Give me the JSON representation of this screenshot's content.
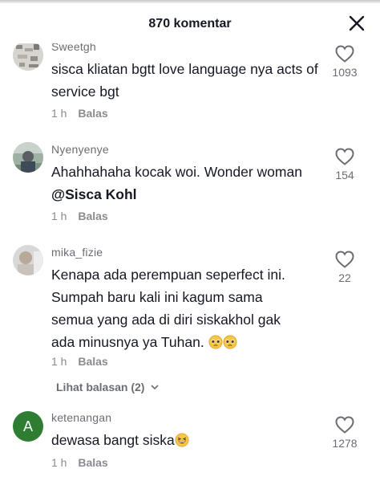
{
  "header": {
    "title": "870 komentar",
    "close_icon": "close-icon"
  },
  "comments": [
    {
      "username": "Sweetgh",
      "text": "sisca kliatan bgtt love language nya acts of service bgt",
      "time": "1 h",
      "reply_label": "Balas",
      "likes": "1093"
    },
    {
      "username": "Nyenyenye",
      "text": "Ahahhahaha kocak woi. Wonder woman",
      "mention": "@Sisca Kohl",
      "time": "1 h",
      "reply_label": "Balas",
      "likes": "154"
    },
    {
      "username": "mika_fizie",
      "text": "Kenapa ada perempuan seperfect ini. Sumpah baru kali ini kagum sama semua yang ada di diri siskakhol gak ada minusnya ya Tuhan.",
      "emoji": "pleading-face-emoji",
      "time": "1 h",
      "reply_label": "Balas",
      "likes": "22",
      "view_replies": "Lihat balasan (2)"
    },
    {
      "username": "ketenangan",
      "avatar_letter": "A",
      "avatar_color": "#2e7d32",
      "text": "dewasa bangt siska",
      "emoji": "grinning-squinting-face-emoji",
      "time": "1 h",
      "reply_label": "Balas",
      "likes": "1278"
    }
  ]
}
